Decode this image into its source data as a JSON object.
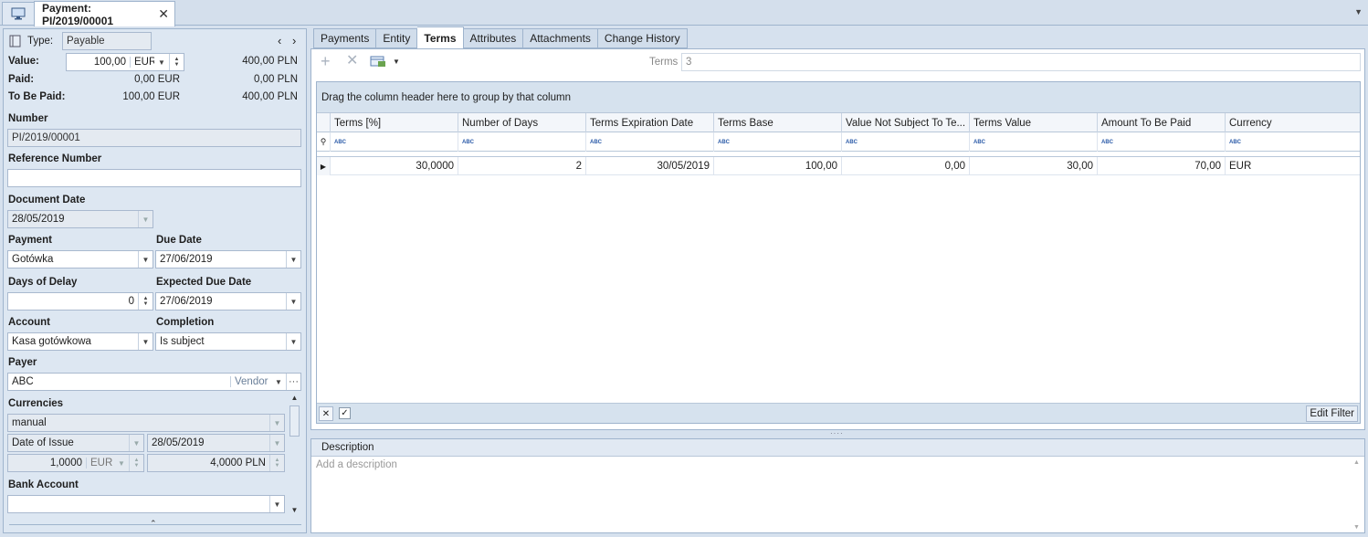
{
  "window": {
    "tab_title": "Payment: PI/2019/00001"
  },
  "left": {
    "type_label": "Type:",
    "type_value": "Payable",
    "value_label": "Value:",
    "value_amount": "100,00",
    "value_currency": "EUR",
    "value_pln": "400,00 PLN",
    "paid_label": "Paid:",
    "paid_eur": "0,00 EUR",
    "paid_pln": "0,00 PLN",
    "tobepaid_label": "To Be Paid:",
    "tobepaid_eur": "100,00 EUR",
    "tobepaid_pln": "400,00 PLN",
    "number_label": "Number",
    "number_value": "PI/2019/00001",
    "refnum_label": "Reference Number",
    "refnum_value": "",
    "docdate_label": "Document Date",
    "docdate_value": "28/05/2019",
    "payment_label": "Payment",
    "payment_value": "Gotówka",
    "duedate_label": "Due Date",
    "duedate_value": "27/06/2019",
    "delay_label": "Days of Delay",
    "delay_value": "0",
    "expdue_label": "Expected Due Date",
    "expdue_value": "27/06/2019",
    "account_label": "Account",
    "account_value": "Kasa gotówkowa",
    "completion_label": "Completion",
    "completion_value": "Is subject",
    "payer_label": "Payer",
    "payer_value": "ABC",
    "payer_type": "Vendor",
    "more_label": "···",
    "currencies_label": "Currencies",
    "cur_mode": "manual",
    "cur_date_type": "Date of Issue",
    "cur_date": "28/05/2019",
    "cur_rate": "1,0000",
    "cur_rate_currency": "EUR",
    "cur_rate_pln": "4,0000 PLN",
    "bank_label": "Bank Account",
    "bank_value": ""
  },
  "tabs": [
    {
      "label": "Payments"
    },
    {
      "label": "Entity"
    },
    {
      "label": "Terms"
    },
    {
      "label": "Attributes"
    },
    {
      "label": "Attachments"
    },
    {
      "label": "Change History"
    }
  ],
  "toolbar": {
    "terms_label": "Terms",
    "terms_value": "3"
  },
  "grid": {
    "group_hint": "Drag the column header here to group by that column",
    "columns": [
      "Terms [%]",
      "Number of Days",
      "Terms Expiration Date",
      "Terms Base",
      "Value Not Subject To Te...",
      "Terms Value",
      "Amount To Be Paid",
      "Currency"
    ],
    "filter_icon_text": "ABC",
    "rows": [
      [
        "30,0000",
        "2",
        "30/05/2019",
        "100,00",
        "0,00",
        "30,00",
        "70,00",
        "EUR"
      ]
    ],
    "edit_filter": "Edit Filter"
  },
  "description": {
    "label": "Description",
    "placeholder": "Add a description"
  },
  "colors": {
    "accent": "#9fb4cd",
    "panel": "#dde7f2"
  },
  "icons": [
    "monitor-icon",
    "close-icon",
    "add-icon",
    "delete-icon",
    "export-icon",
    "book-icon",
    "filter-pin-icon"
  ]
}
